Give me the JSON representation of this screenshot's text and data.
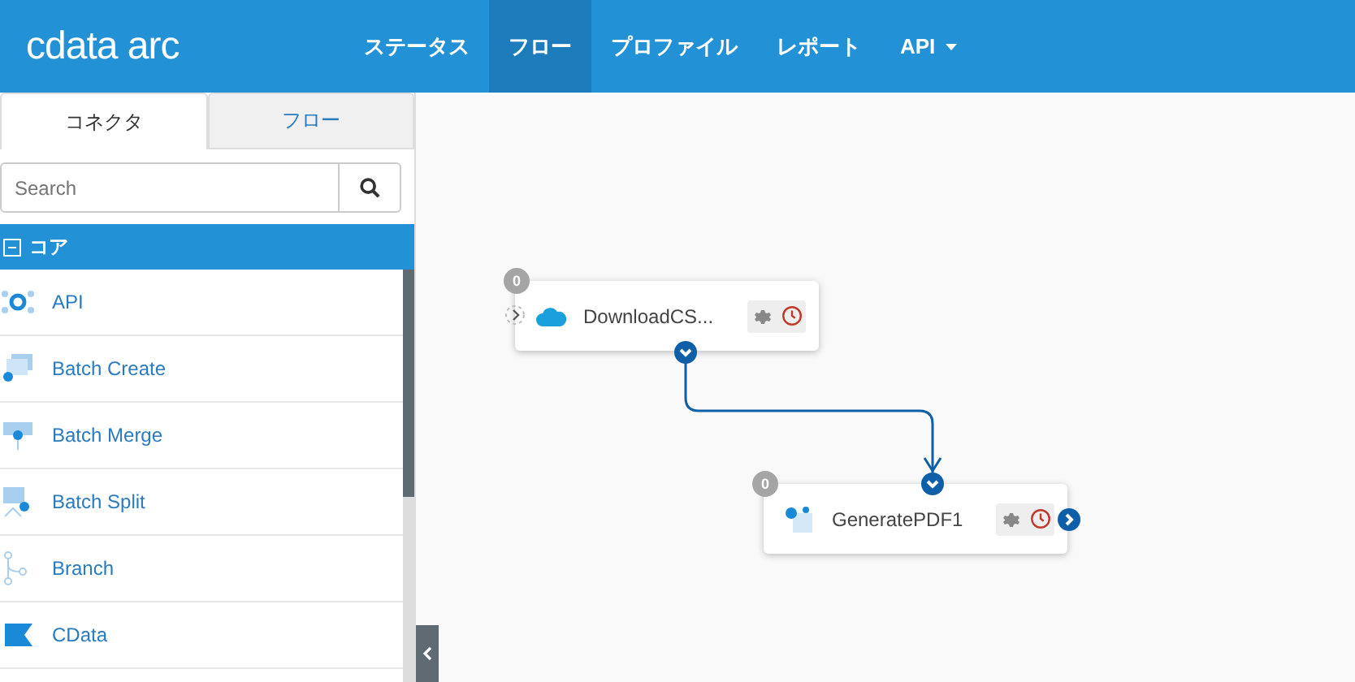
{
  "header": {
    "logo": "cdata arc",
    "nav": [
      {
        "label": "ステータス",
        "selected": false,
        "dropdown": false
      },
      {
        "label": "フロー",
        "selected": true,
        "dropdown": false
      },
      {
        "label": "プロファイル",
        "selected": false,
        "dropdown": false
      },
      {
        "label": "レポート",
        "selected": false,
        "dropdown": false
      },
      {
        "label": "API",
        "selected": false,
        "dropdown": true
      }
    ]
  },
  "sidebar": {
    "tabs": [
      {
        "label": "コネクタ",
        "selected": true
      },
      {
        "label": "フロー",
        "selected": false
      }
    ],
    "search": {
      "placeholder": "Search"
    },
    "category": {
      "label": "コア",
      "expanded": true
    },
    "items": [
      "API",
      "Batch Create",
      "Batch Merge",
      "Batch Split",
      "Branch",
      "CData"
    ]
  },
  "flow": {
    "nodes": [
      {
        "name": "DownloadCS...",
        "count": "0"
      },
      {
        "name": "GeneratePDF1",
        "count": "0"
      }
    ]
  }
}
